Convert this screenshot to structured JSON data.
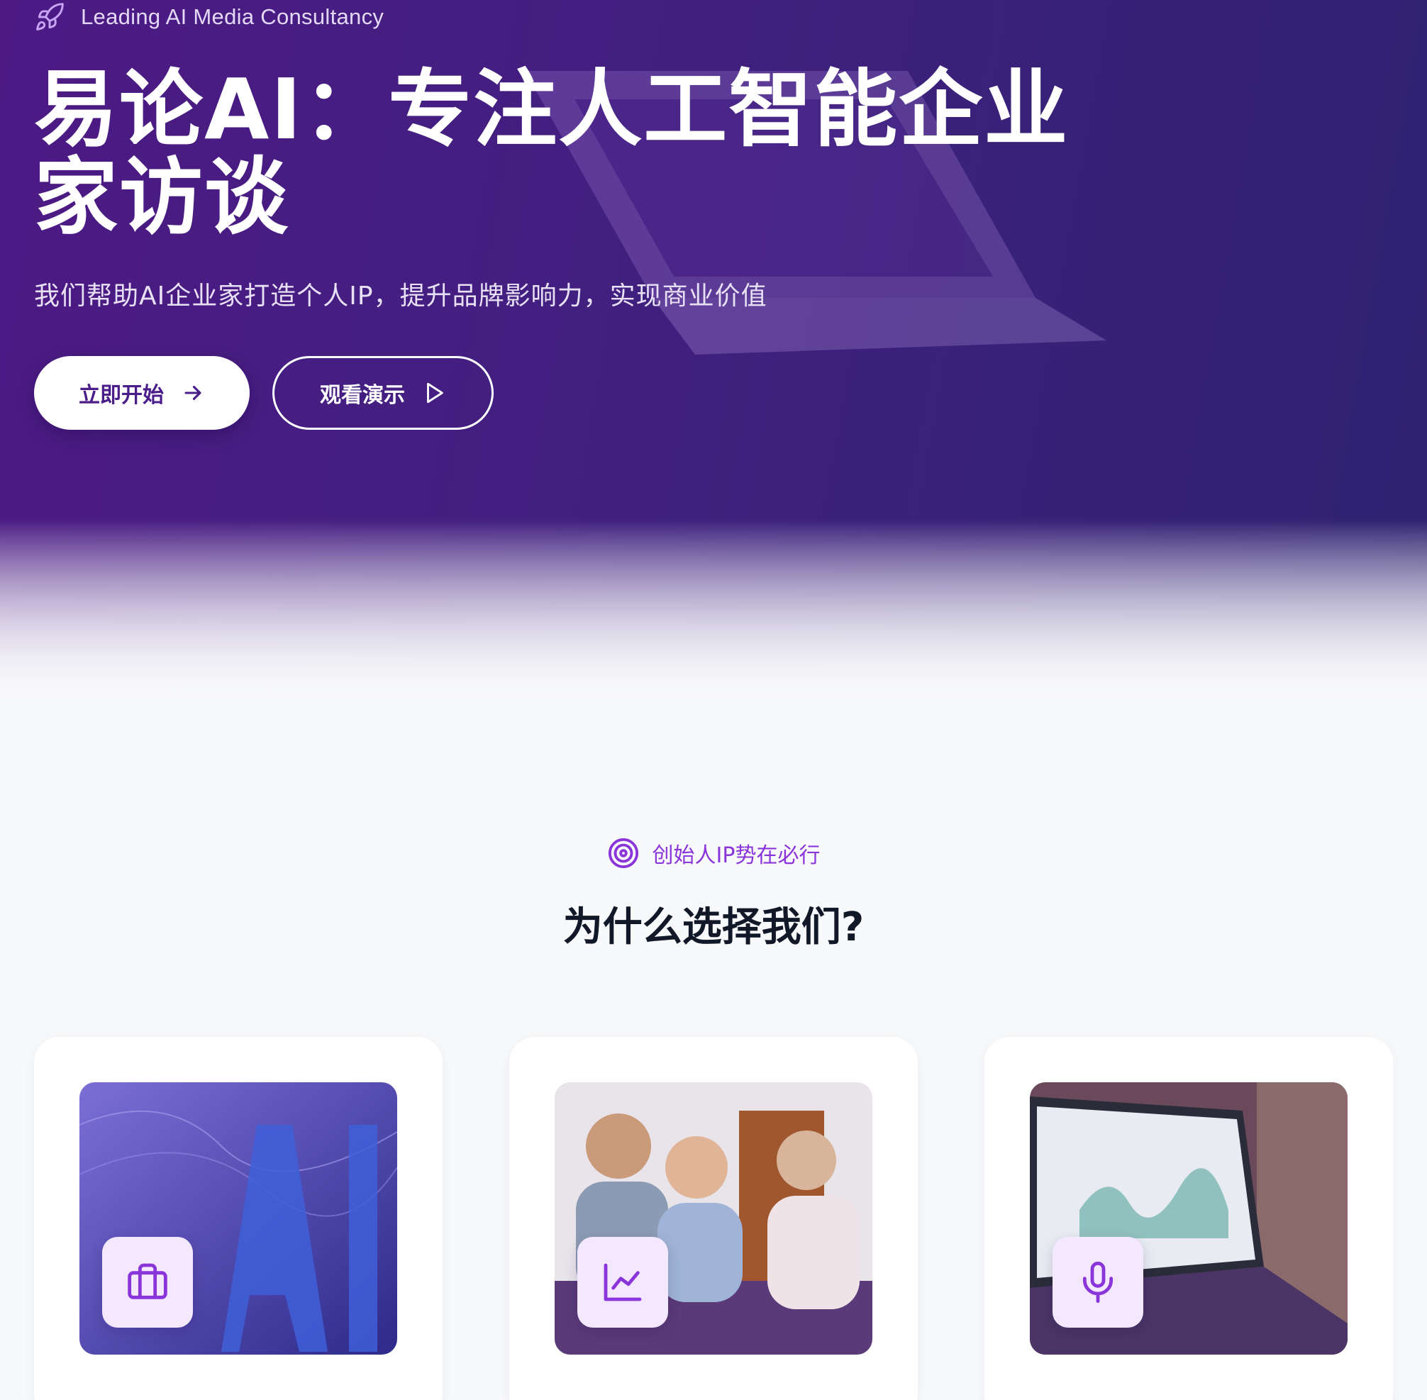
{
  "hero": {
    "badge": "Leading AI Media Consultancy",
    "title": "易论AI：专注人工智能企业家访谈",
    "subtitle": "我们帮助AI企业家打造个人IP，提升品牌影响力，实现商业价值",
    "primary_button": "立即开始",
    "secondary_button": "观看演示"
  },
  "why": {
    "tag": "创始人IP势在必行",
    "title": "为什么选择我们?",
    "cards": [
      {
        "icon": "briefcase-icon"
      },
      {
        "icon": "chart-line-icon"
      },
      {
        "icon": "microphone-icon"
      }
    ]
  },
  "colors": {
    "hero_bg_start": "#4d1a84",
    "hero_bg_end": "#2e2270",
    "accent": "#8a35d9",
    "icon_tile_bg": "#f3e8ff",
    "title_text": "#111827"
  }
}
